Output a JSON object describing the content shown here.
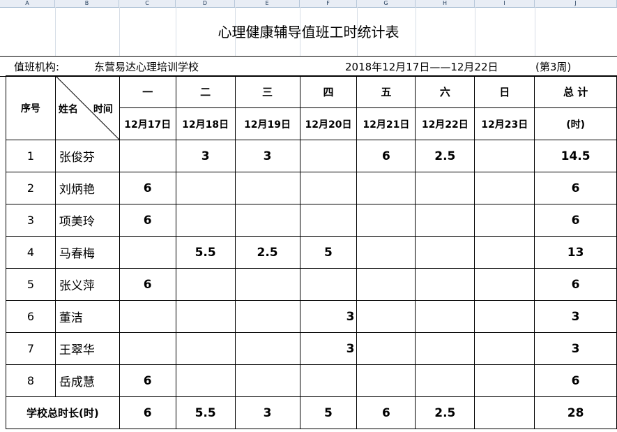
{
  "columns": [
    "A",
    "B",
    "C",
    "D",
    "E",
    "F",
    "G",
    "H",
    "I",
    "J"
  ],
  "title": "心理健康辅导值班工时统计表",
  "info": {
    "org_label": "值班机构:",
    "org_name": "东营易达心理培训学校",
    "date_range": "2018年12月17日——12月22日",
    "week": "(第3周)"
  },
  "header": {
    "seq": "序号",
    "name": "姓名",
    "time": "时间",
    "days": [
      "一",
      "二",
      "三",
      "四",
      "五",
      "六",
      "日"
    ],
    "dates": [
      "12月17日",
      "12月18日",
      "12月19日",
      "12月20日",
      "12月21日",
      "12月22日",
      "12月23日"
    ],
    "total": "总 计",
    "total_unit": "(时)"
  },
  "rows": [
    {
      "idx": "1",
      "name": "张俊芬",
      "vals": [
        "",
        "3",
        "3",
        "",
        "6",
        "2.5",
        ""
      ],
      "total": "14.5"
    },
    {
      "idx": "2",
      "name": "刘炳艳",
      "vals": [
        "6",
        "",
        "",
        "",
        "",
        "",
        ""
      ],
      "total": "6"
    },
    {
      "idx": "3",
      "name": "项美玲",
      "vals": [
        "6",
        "",
        "",
        "",
        "",
        "",
        ""
      ],
      "total": "6"
    },
    {
      "idx": "4",
      "name": "马春梅",
      "vals": [
        "",
        "5.5",
        "2.5",
        "5",
        "",
        "",
        ""
      ],
      "total": "13"
    },
    {
      "idx": "5",
      "name": "张义萍",
      "vals": [
        "6",
        "",
        "",
        "",
        "",
        "",
        ""
      ],
      "total": "6"
    },
    {
      "idx": "6",
      "name": "董洁",
      "vals": [
        "",
        "",
        "",
        "3",
        "",
        "",
        ""
      ],
      "total": "3"
    },
    {
      "idx": "7",
      "name": "王翠华",
      "vals": [
        "",
        "",
        "",
        "3",
        "",
        "",
        ""
      ],
      "total": "3"
    },
    {
      "idx": "8",
      "name": "岳成慧",
      "vals": [
        "6",
        "",
        "",
        "",
        "",
        "",
        ""
      ],
      "total": "6"
    }
  ],
  "footer": {
    "label": "学校总时长(时)",
    "vals": [
      "6",
      "5.5",
      "3",
      "5",
      "6",
      "2.5",
      ""
    ],
    "total": "28"
  }
}
